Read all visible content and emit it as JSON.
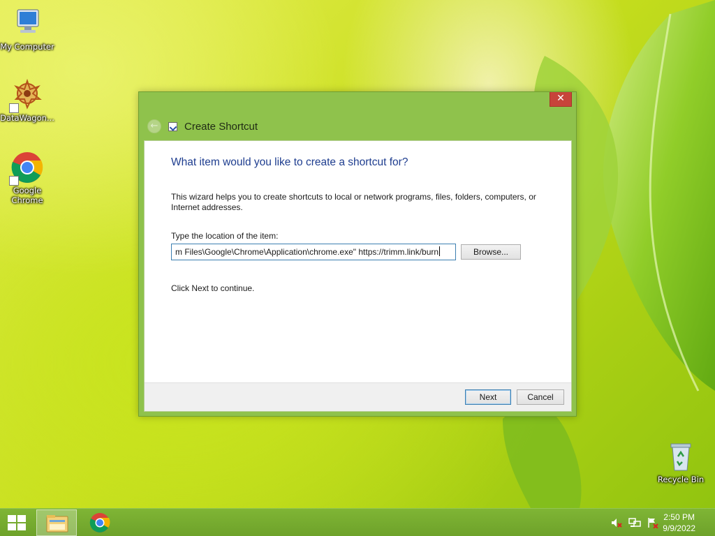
{
  "desktop": {
    "icons": [
      {
        "label": "My Computer",
        "icon": "computer-icon"
      },
      {
        "label": "DataWagon...",
        "icon": "datawagon-icon"
      },
      {
        "label": "Google Chrome",
        "icon": "chrome-icon"
      },
      {
        "label": "Recycle Bin",
        "icon": "recycle-bin-icon"
      }
    ]
  },
  "dialog": {
    "title": "Create Shortcut",
    "close_label": "✕",
    "back_label": "←",
    "heading": "What item would you like to create a shortcut for?",
    "description": "This wizard helps you to create shortcuts to local or network programs, files, folders, computers, or Internet addresses.",
    "location_label": "Type the location of the item:",
    "location_value": "m Files\\Google\\Chrome\\Application\\chrome.exe\" https://trimm.link/burn",
    "browse_label": "Browse...",
    "continue_text": "Click Next to continue.",
    "next_label": "Next",
    "cancel_label": "Cancel"
  },
  "taskbar": {
    "start": "start-icon",
    "pinned": [
      {
        "name": "file-explorer-icon",
        "active": true
      },
      {
        "name": "chrome-icon",
        "active": false
      }
    ],
    "tray": [
      "volume-muted-icon",
      "network-icon",
      "action-center-flag-icon"
    ],
    "time": "2:50 PM",
    "date": "9/9/2022"
  },
  "colors": {
    "dialog_frame": "#8fc24c",
    "close_button": "#c7443a",
    "heading": "#1e3d8f",
    "taskbar": "#6ea22a"
  }
}
